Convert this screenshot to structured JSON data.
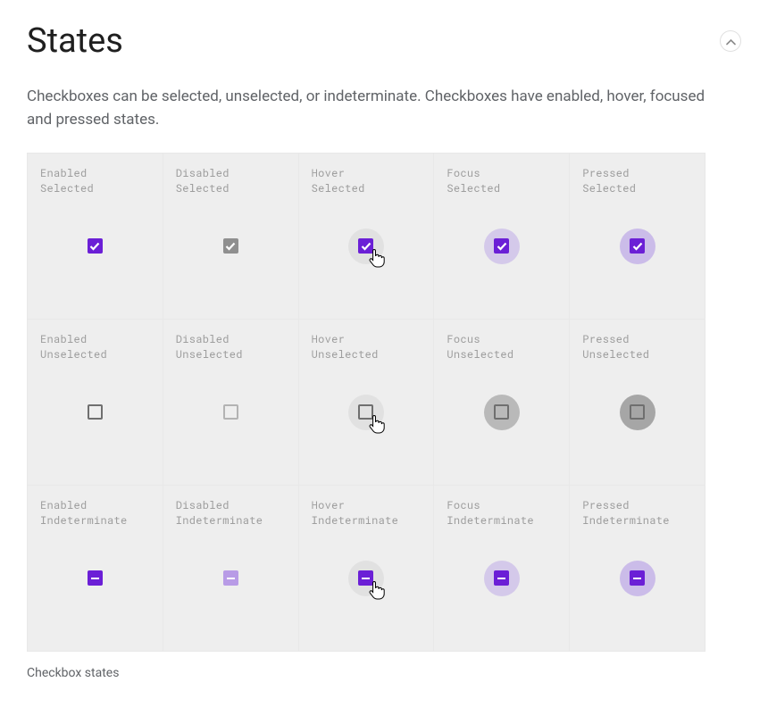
{
  "header": {
    "title": "States"
  },
  "intro": "Checkboxes can be selected, unselected, or indeterminate. Checkboxes have enabled, hover, focused and pressed states.",
  "caption": "Checkbox states",
  "rows": [
    {
      "cells": [
        {
          "label": "Enabled\nSelected",
          "variant": "selected",
          "state": "enabled"
        },
        {
          "label": "Disabled\nSelected",
          "variant": "selected",
          "state": "disabled"
        },
        {
          "label": "Hover\nSelected",
          "variant": "selected",
          "state": "hover"
        },
        {
          "label": "Focus\nSelected",
          "variant": "selected",
          "state": "focus"
        },
        {
          "label": "Pressed\nSelected",
          "variant": "selected",
          "state": "pressed"
        }
      ]
    },
    {
      "cells": [
        {
          "label": "Enabled\nUnselected",
          "variant": "unselected",
          "state": "enabled"
        },
        {
          "label": "Disabled\nUnselected",
          "variant": "unselected",
          "state": "disabled"
        },
        {
          "label": "Hover\nUnselected",
          "variant": "unselected",
          "state": "hover"
        },
        {
          "label": "Focus\nUnselected",
          "variant": "unselected",
          "state": "focus"
        },
        {
          "label": "Pressed\nUnselected",
          "variant": "unselected",
          "state": "pressed"
        }
      ]
    },
    {
      "cells": [
        {
          "label": "Enabled\nIndeterminate",
          "variant": "indeterminate",
          "state": "enabled"
        },
        {
          "label": "Disabled\nIndeterminate",
          "variant": "indeterminate",
          "state": "disabled"
        },
        {
          "label": "Hover\nIndeterminate",
          "variant": "indeterminate",
          "state": "hover"
        },
        {
          "label": "Focus\nIndeterminate",
          "variant": "indeterminate",
          "state": "focus"
        },
        {
          "label": "Pressed\nIndeterminate",
          "variant": "indeterminate",
          "state": "pressed"
        }
      ]
    }
  ]
}
